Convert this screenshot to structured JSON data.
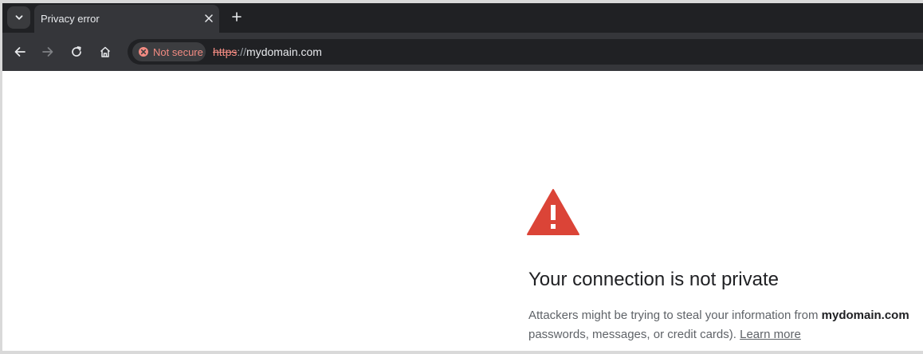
{
  "tab": {
    "title": "Privacy error"
  },
  "security_chip": {
    "label": "Not secure"
  },
  "address": {
    "scheme": "https",
    "separator": "://",
    "host": "mydomain.com"
  },
  "page": {
    "heading": "Your connection is not private",
    "body_before": "Attackers might be trying to steal your information from ",
    "body_domain": "mydomain.com",
    "body_after": "passwords, messages, or credit cards).",
    "learn_more": "Learn more"
  },
  "colors": {
    "warning": "#db4437",
    "insecure": "#f28b82",
    "chrome_dark": "#202124"
  }
}
